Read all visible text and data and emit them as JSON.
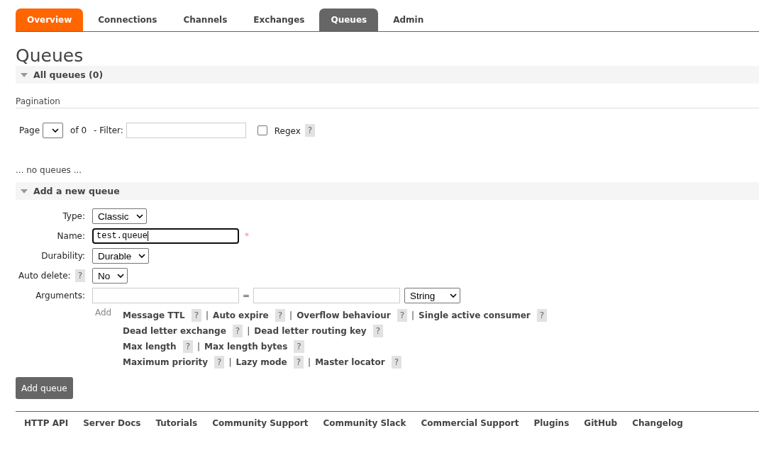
{
  "tabs": [
    {
      "label": "Overview",
      "selected": false,
      "highlight": true
    },
    {
      "label": "Connections",
      "selected": false,
      "highlight": false
    },
    {
      "label": "Channels",
      "selected": false,
      "highlight": false
    },
    {
      "label": "Exchanges",
      "selected": false,
      "highlight": false
    },
    {
      "label": "Queues",
      "selected": true,
      "highlight": false
    },
    {
      "label": "Admin",
      "selected": false,
      "highlight": false
    }
  ],
  "page_title": "Queues",
  "all_queues": {
    "title": "All queues (0)",
    "expanded": true,
    "pagination": {
      "heading": "Pagination",
      "page_label": "Page",
      "of_label": "of 0",
      "filter_label": "- Filter:",
      "regex_label": "Regex",
      "regex_checked": false,
      "regex_help": "?"
    },
    "empty_text": "... no queues ..."
  },
  "add_queue": {
    "title": "Add a new queue",
    "expanded": true,
    "fields": [
      {
        "kind": "select",
        "label": "Type:",
        "value": "Classic"
      },
      {
        "kind": "text",
        "label": "Name:",
        "value": "test.queue",
        "required": "*"
      },
      {
        "kind": "select",
        "label": "Durability:",
        "value": "Durable"
      },
      {
        "kind": "select",
        "label": "Auto delete:",
        "help": "?",
        "value": "No"
      }
    ],
    "arguments": {
      "label": "Arguments:",
      "equals": "=",
      "type": "String",
      "add_label": "Add",
      "rows": [
        [
          {
            "label": "Message TTL",
            "help": "?",
            "separator": "|"
          },
          {
            "label": "Auto expire",
            "help": "?",
            "separator": "|"
          },
          {
            "label": "Overflow behaviour",
            "help": "?",
            "separator": "|"
          },
          {
            "label": "Single active consumer",
            "help": "?"
          }
        ],
        [
          {
            "label": "Dead letter exchange",
            "help": "?",
            "separator": "|"
          },
          {
            "label": "Dead letter routing key",
            "help": "?"
          }
        ],
        [
          {
            "label": "Max length",
            "help": "?",
            "separator": "|"
          },
          {
            "label": "Max length bytes",
            "help": "?"
          }
        ],
        [
          {
            "label": "Maximum priority",
            "help": "?",
            "separator": "|"
          },
          {
            "label": "Lazy mode",
            "help": "?",
            "separator": "|"
          },
          {
            "label": "Master locator",
            "help": "?"
          }
        ]
      ]
    },
    "submit": "Add queue"
  },
  "footer_links": [
    "HTTP API",
    "Server Docs",
    "Tutorials",
    "Community Support",
    "Community Slack",
    "Commercial Support",
    "Plugins",
    "GitHub",
    "Changelog"
  ]
}
